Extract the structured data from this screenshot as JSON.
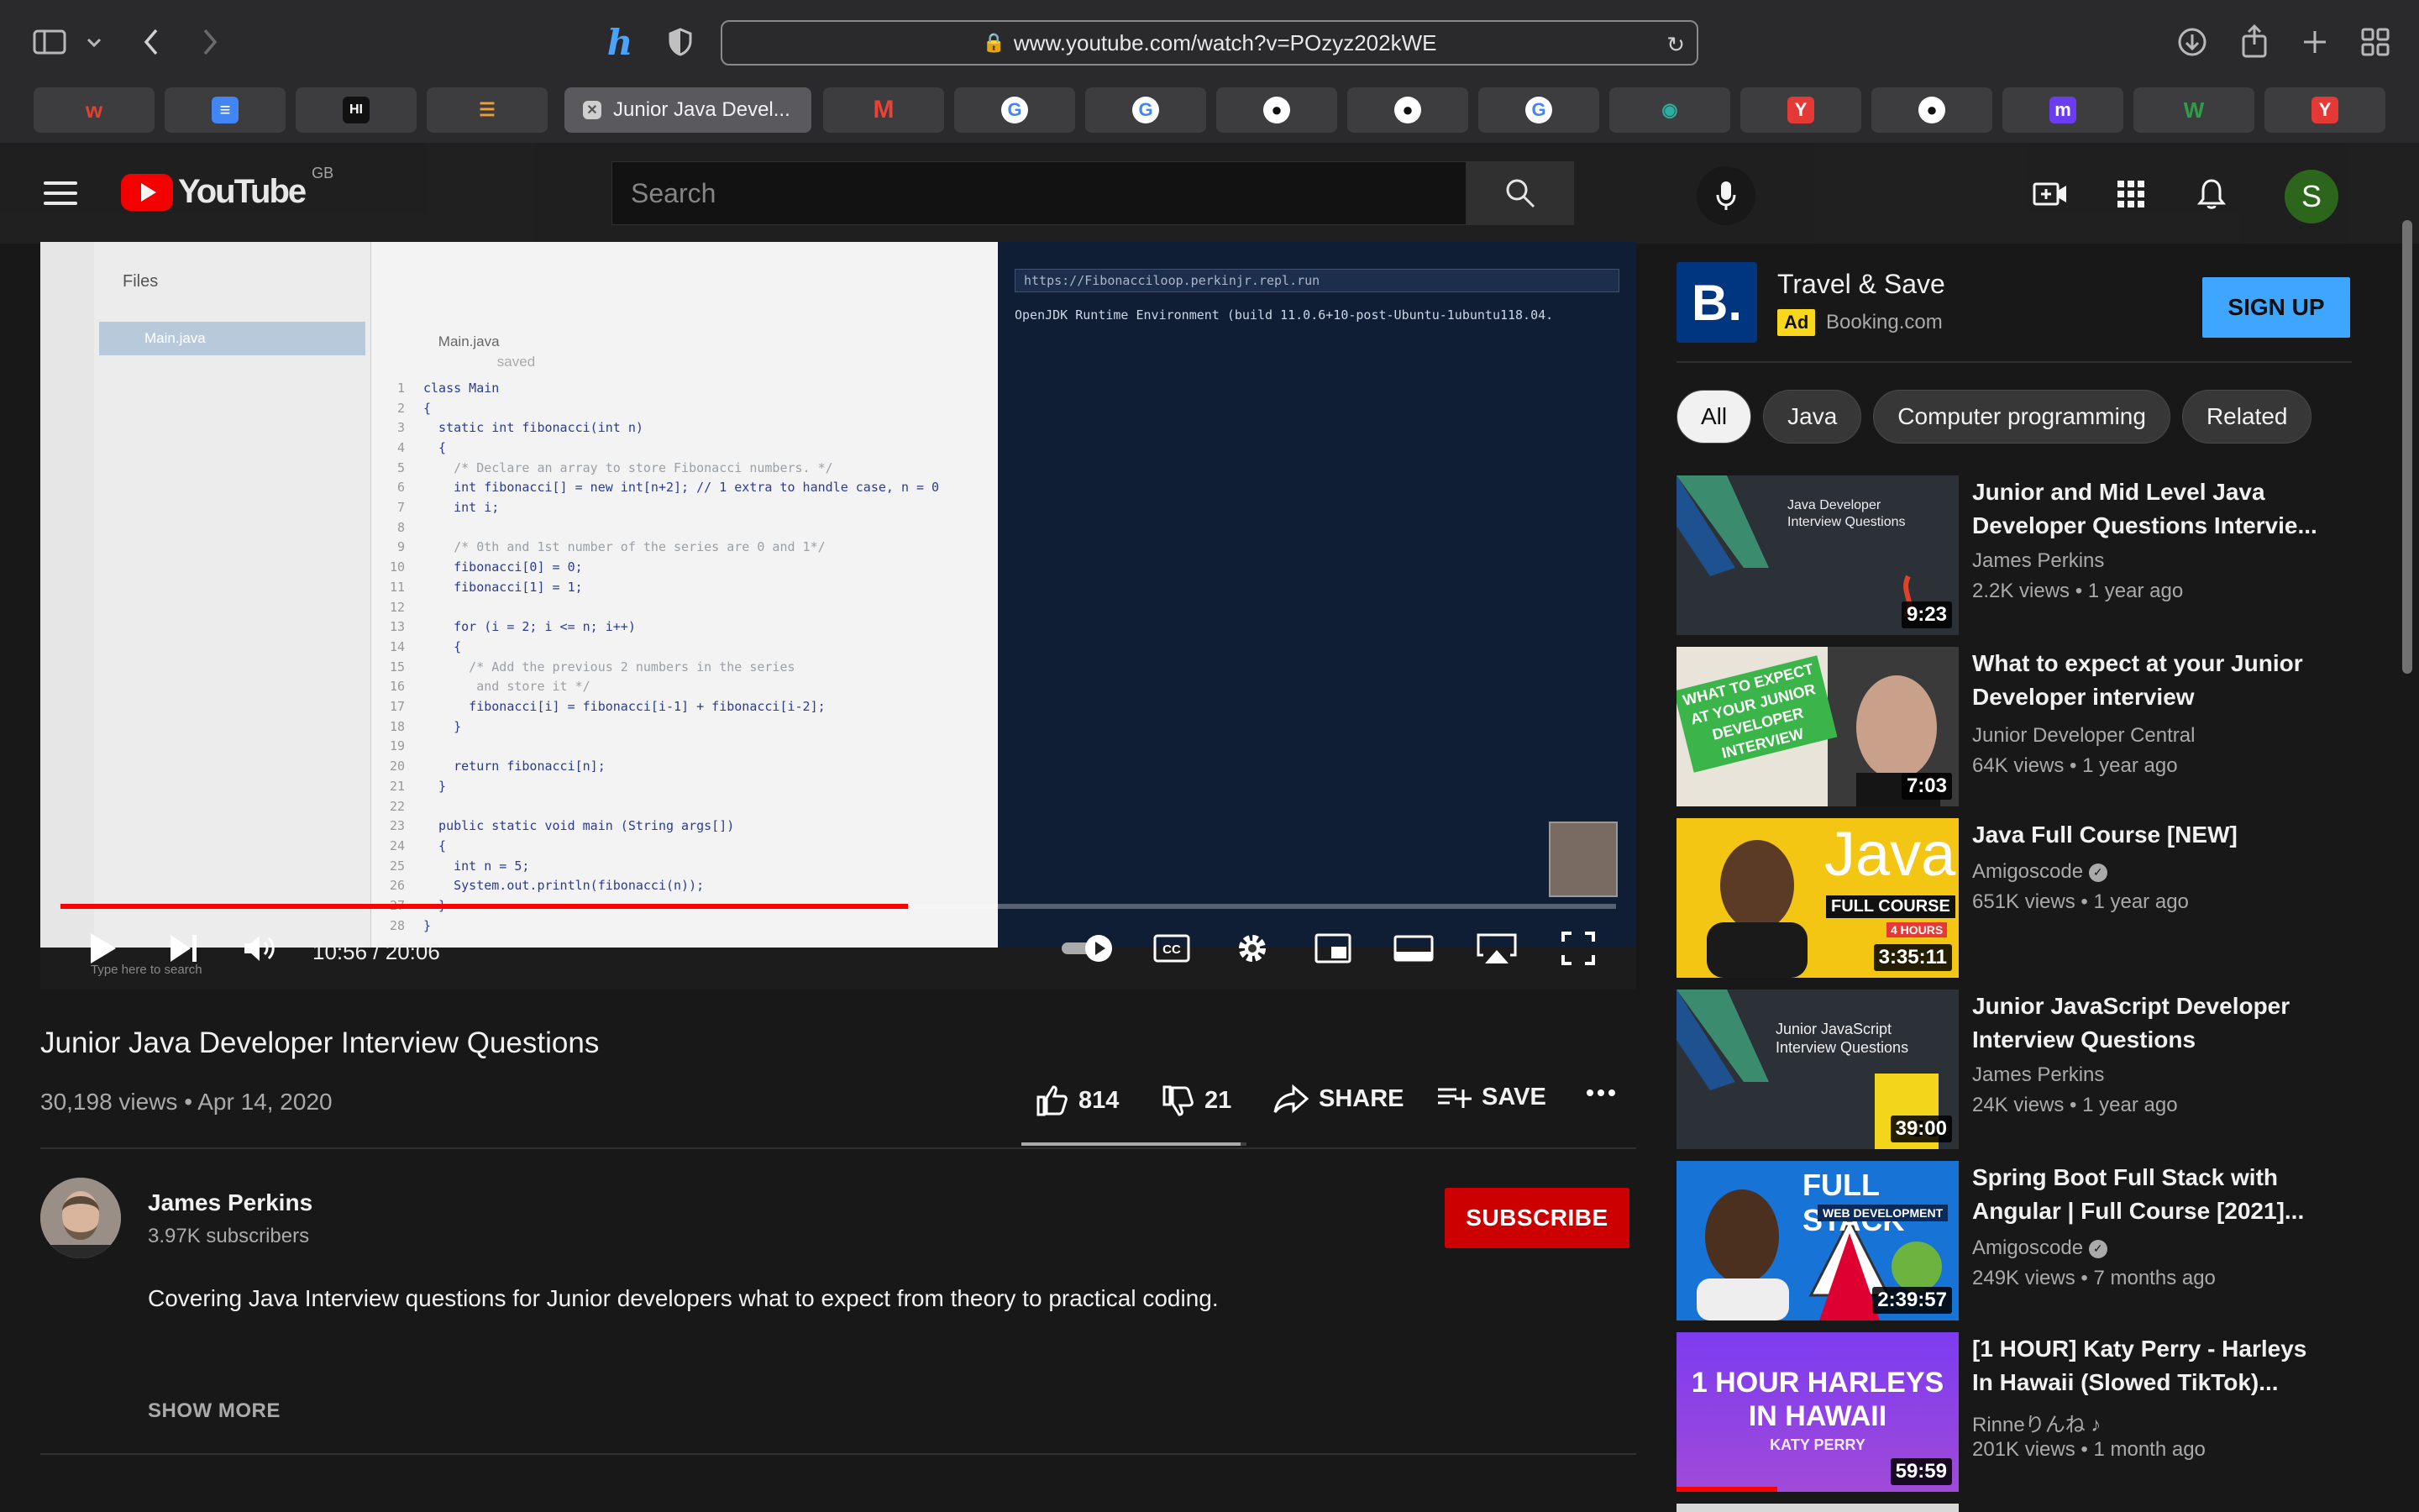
{
  "browser": {
    "url": "www.youtube.com/watch?v=POzyz202kWE",
    "active_tab_title": "Junior Java Devel...",
    "tabs": [
      "w",
      "docs",
      "hi",
      "sol",
      "active",
      "gmail",
      "google",
      "google",
      "github",
      "github",
      "google",
      "eye",
      "y",
      "gh",
      "m",
      "w3",
      "y"
    ]
  },
  "header": {
    "logo_text": "YouTube",
    "region": "GB",
    "search_placeholder": "Search",
    "avatar_letter": "S"
  },
  "player": {
    "time": "10:56 / 20:06",
    "progress": 0.545,
    "code_tab": "Main.java",
    "saved_label": "saved",
    "files_label": "Files",
    "file_item": "Main.java",
    "repl_url": "https://Fibonacciloop.perkinjr.repl.run",
    "terminal_line": "OpenJDK Runtime Environment (build 11.0.6+10-post-Ubuntu-1ubuntu118.04.",
    "code_lines": [
      "class Main",
      "{",
      "  static int fibonacci(int n)",
      "  {",
      "    /* Declare an array to store Fibonacci numbers. */",
      "    int fibonacci[] = new int[n+2]; // 1 extra to handle case, n = 0",
      "    int i;",
      "",
      "    /* 0th and 1st number of the series are 0 and 1*/",
      "    fibonacci[0] = 0;",
      "    fibonacci[1] = 1;",
      "",
      "    for (i = 2; i <= n; i++)",
      "    {",
      "      /* Add the previous 2 numbers in the series",
      "       and store it */",
      "      fibonacci[i] = fibonacci[i-1] + fibonacci[i-2];",
      "    }",
      "",
      "    return fibonacci[n];",
      "  }",
      "",
      "  public static void main (String args[])",
      "  {",
      "    int n = 5;",
      "    System.out.println(fibonacci(n));",
      "  }",
      "}"
    ],
    "taskbar_search": "Type here to search"
  },
  "video": {
    "title": "Junior Java Developer Interview Questions",
    "views_date": "30,198 views • Apr 14, 2020",
    "likes": "814",
    "dislikes": "21",
    "like_ratio": 0.975,
    "share_label": "SHARE",
    "save_label": "SAVE",
    "more_label": "..."
  },
  "channel": {
    "name": "James Perkins",
    "subscribers": "3.97K subscribers",
    "subscribe_label": "SUBSCRIBE",
    "description": "Covering Java Interview questions for Junior developers what to expect from theory to practical coding.",
    "show_more": "SHOW MORE"
  },
  "ad": {
    "logo_letter": "B.",
    "title": "Travel & Save",
    "badge": "Ad",
    "domain": "Booking.com",
    "cta": "SIGN UP"
  },
  "chips": [
    "All",
    "Java",
    "Computer programming",
    "Related"
  ],
  "recommendations": [
    {
      "title": "Junior and Mid Level Java Developer Questions Intervie...",
      "channel": "James Perkins",
      "meta": "2.2K views • 1 year ago",
      "duration": "9:23",
      "thumb_text": "Java Developer Interview Questions",
      "verified": false
    },
    {
      "title": "What to expect at your Junior Developer interview",
      "channel": "Junior Developer Central",
      "meta": "64K views • 1 year ago",
      "duration": "7:03",
      "thumb_text": "WHAT TO EXPECT AT YOUR JUNIOR DEVELOPER INTERVIEW",
      "verified": false
    },
    {
      "title": "Java Full Course [NEW]",
      "channel": "Amigoscode",
      "meta": "651K views • 1 year ago",
      "duration": "3:35:11",
      "thumb_text": "Java",
      "thumb_sub": "FULL COURSE",
      "thumb_sub2": "4 HOURS",
      "verified": true
    },
    {
      "title": "Junior JavaScript Developer Interview Questions",
      "channel": "James Perkins",
      "meta": "24K views • 1 year ago",
      "duration": "39:00",
      "thumb_text": "Junior JavaScript Interview Questions",
      "thumb_sub": "JS",
      "verified": false
    },
    {
      "title": "Spring Boot Full Stack with Angular | Full Course [2021]...",
      "channel": "Amigoscode",
      "meta": "249K views • 7 months ago",
      "duration": "2:39:57",
      "thumb_text": "FULL STACK",
      "thumb_sub": "WEB DEVELOPMENT",
      "verified": true
    },
    {
      "title": "[1 HOUR] Katy Perry - Harleys In Hawaii (Slowed TikTok)...",
      "channel": "Rinneりんね ♪",
      "meta": "201K views • 1 month ago",
      "duration": "59:59",
      "thumb_text": "1 HOUR HARLEYS IN HAWAII",
      "thumb_sub": "KATY PERRY",
      "verified": false
    }
  ],
  "colors": {
    "accent_red": "#ff0000",
    "subscribe_red": "#cc0000",
    "signup_blue": "#3ea6ff",
    "booking_blue": "#003580"
  }
}
